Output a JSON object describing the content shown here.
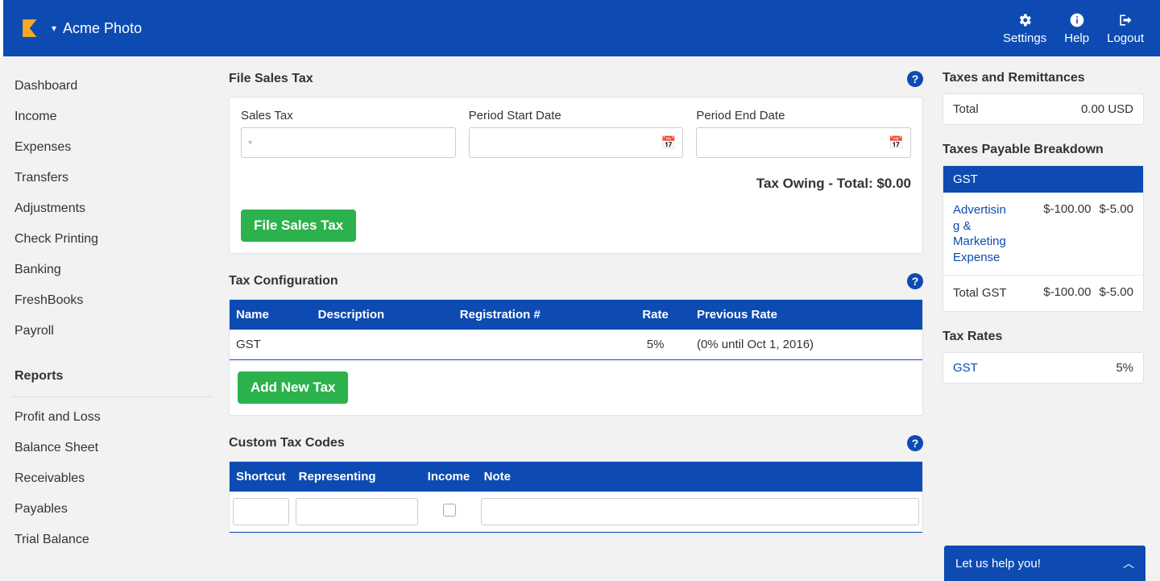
{
  "header": {
    "company": "Acme Photo",
    "actions": {
      "settings": "Settings",
      "help": "Help",
      "logout": "Logout"
    }
  },
  "sidebar": {
    "main": [
      "Dashboard",
      "Income",
      "Expenses",
      "Transfers",
      "Adjustments",
      "Check Printing",
      "Banking",
      "FreshBooks",
      "Payroll"
    ],
    "reports_label": "Reports",
    "reports": [
      "Profit and Loss",
      "Balance Sheet",
      "Receivables",
      "Payables",
      "Trial Balance"
    ]
  },
  "file_sales_tax": {
    "title": "File Sales Tax",
    "fields": {
      "sales_tax": "Sales Tax",
      "start": "Period Start Date",
      "end": "Period End Date"
    },
    "owing": "Tax Owing - Total: $0.00",
    "button": "File Sales Tax"
  },
  "tax_config": {
    "title": "Tax Configuration",
    "headers": {
      "name": "Name",
      "desc": "Description",
      "reg": "Registration #",
      "rate": "Rate",
      "prev": "Previous Rate"
    },
    "rows": [
      {
        "name": "GST",
        "desc": "",
        "reg": "",
        "rate": "5%",
        "prev": "(0% until Oct 1, 2016)"
      }
    ],
    "add_button": "Add New Tax"
  },
  "custom_codes": {
    "title": "Custom Tax Codes",
    "headers": {
      "shortcut": "Shortcut",
      "rep": "Representing",
      "income": "Income",
      "note": "Note"
    }
  },
  "right": {
    "taxes_remit": {
      "title": "Taxes and Remittances",
      "total_label": "Total",
      "total_value": "0.00 USD"
    },
    "payable": {
      "title": "Taxes Payable Breakdown",
      "gst_label": "GST",
      "rows": [
        {
          "label": "Advertising & Marketing Expense",
          "c1": "$-100.00",
          "c2": "$-5.00"
        }
      ],
      "total": {
        "label": "Total GST",
        "c1": "$-100.00",
        "c2": "$-5.00"
      }
    },
    "rates": {
      "title": "Tax Rates",
      "rows": [
        {
          "name": "GST",
          "pct": "5%"
        }
      ]
    }
  },
  "help_bar": "Let us help you!"
}
